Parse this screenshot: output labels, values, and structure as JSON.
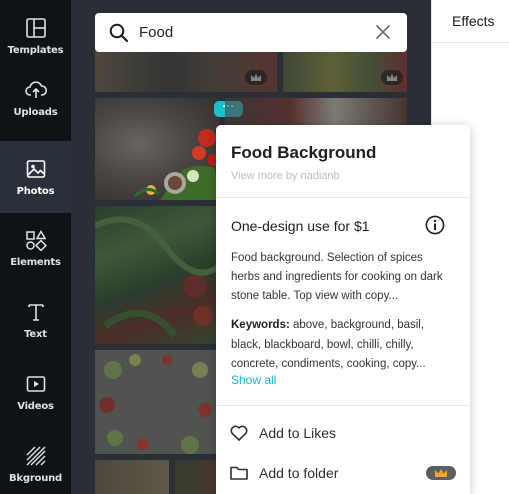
{
  "sidebar": {
    "items": [
      {
        "label": "Templates",
        "icon": "templates-icon"
      },
      {
        "label": "Uploads",
        "icon": "upload-cloud-icon"
      },
      {
        "label": "Photos",
        "icon": "photo-icon",
        "active": true
      },
      {
        "label": "Elements",
        "icon": "shapes-icon"
      },
      {
        "label": "Text",
        "icon": "text-t-icon"
      },
      {
        "label": "Videos",
        "icon": "video-play-icon"
      },
      {
        "label": "Bkground",
        "icon": "background-stripes-icon"
      }
    ]
  },
  "search": {
    "value": "Food",
    "icon": "search-icon"
  },
  "right_panel": {
    "tab_label": "Effects"
  },
  "popover": {
    "title": "Food Background",
    "byline": "View more by nadianb",
    "license": "One-design use for $1",
    "description": "Food background. Selection of spices herbs and ingredients for cooking on dark stone table. Top view with copy...",
    "keywords_label": "Keywords:",
    "keywords": "above, background, basil, black, blackboard, bowl, chilli, chilly, concrete, condiments, cooking, copy...",
    "show_all": "Show all",
    "actions": {
      "likes": "Add to Likes",
      "folder": "Add to folder"
    }
  },
  "colors": {
    "accent": "#18bfcf",
    "rail_bg": "#0e1318",
    "panel_bg": "#2a2f35",
    "crown": "#f6a623"
  },
  "more_button_label": "···"
}
